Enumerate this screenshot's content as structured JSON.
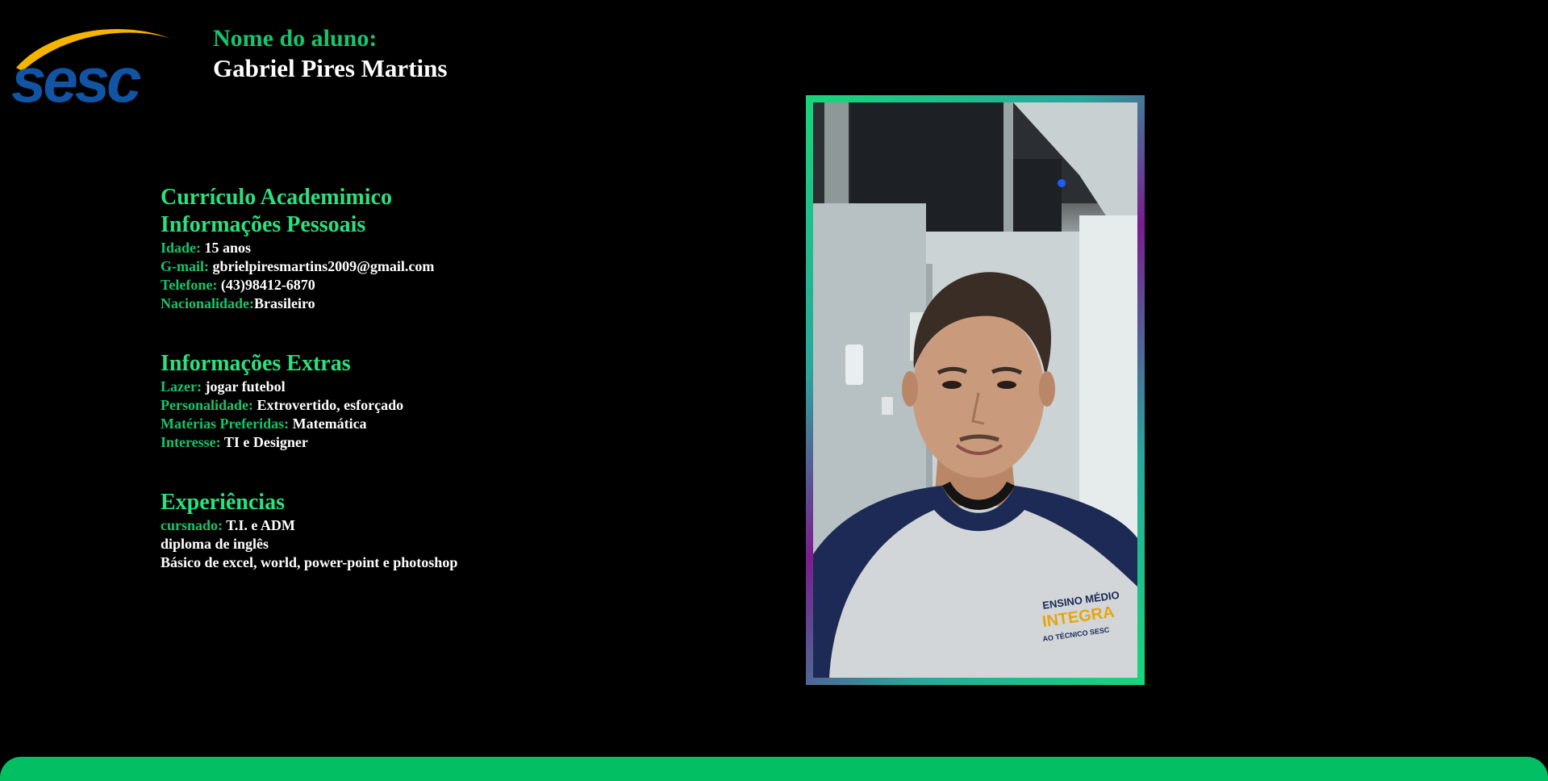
{
  "logo": {
    "text": "sesc"
  },
  "header": {
    "label": "Nome do aluno:",
    "name": "Gabriel Pires Martins"
  },
  "resume": {
    "title": "Currículo Academimico",
    "personal": {
      "heading": "Informações Pessoais",
      "rows": [
        {
          "label": "Idade:",
          "value": " 15 anos"
        },
        {
          "label": "G-mail:",
          "value": " gbrielpiresmartins2009@gmail.com"
        },
        {
          "label": "Telefone:",
          "value": " (43)98412-6870"
        },
        {
          "label": "Nacionalidade:",
          "value": "Brasileiro"
        }
      ]
    },
    "extras": {
      "heading": "Informações Extras",
      "rows": [
        {
          "label": "Lazer:",
          "value": " jogar futebol"
        },
        {
          "label": "Personalidade:",
          "value": " Extrovertido, esforçado"
        },
        {
          "label": "Matérias Preferidas:",
          "value": " Matemática"
        },
        {
          "label": "Interesse:",
          "value": " TI e Designer"
        }
      ]
    },
    "experience": {
      "heading": "Experiências",
      "rows": [
        {
          "label": "cursnado:",
          "value": " T.I. e ADM"
        },
        {
          "label": "",
          "value": "diploma de inglês"
        },
        {
          "label": "",
          "value": "Básico de excel, world, power-point e photoshop"
        }
      ]
    }
  },
  "photo": {
    "shirt_text_1": "ENSINO MÉDIO",
    "shirt_text_2": "INTEGRA",
    "shirt_text_3": "AO TÉCNICO SESC"
  },
  "colors": {
    "background": "#000000",
    "accent_green": "#19c36b",
    "heading_green": "#2be07d",
    "footer_green": "#02bf64",
    "logo_blue": "#1154a4",
    "logo_yellow": "#f4b400"
  }
}
